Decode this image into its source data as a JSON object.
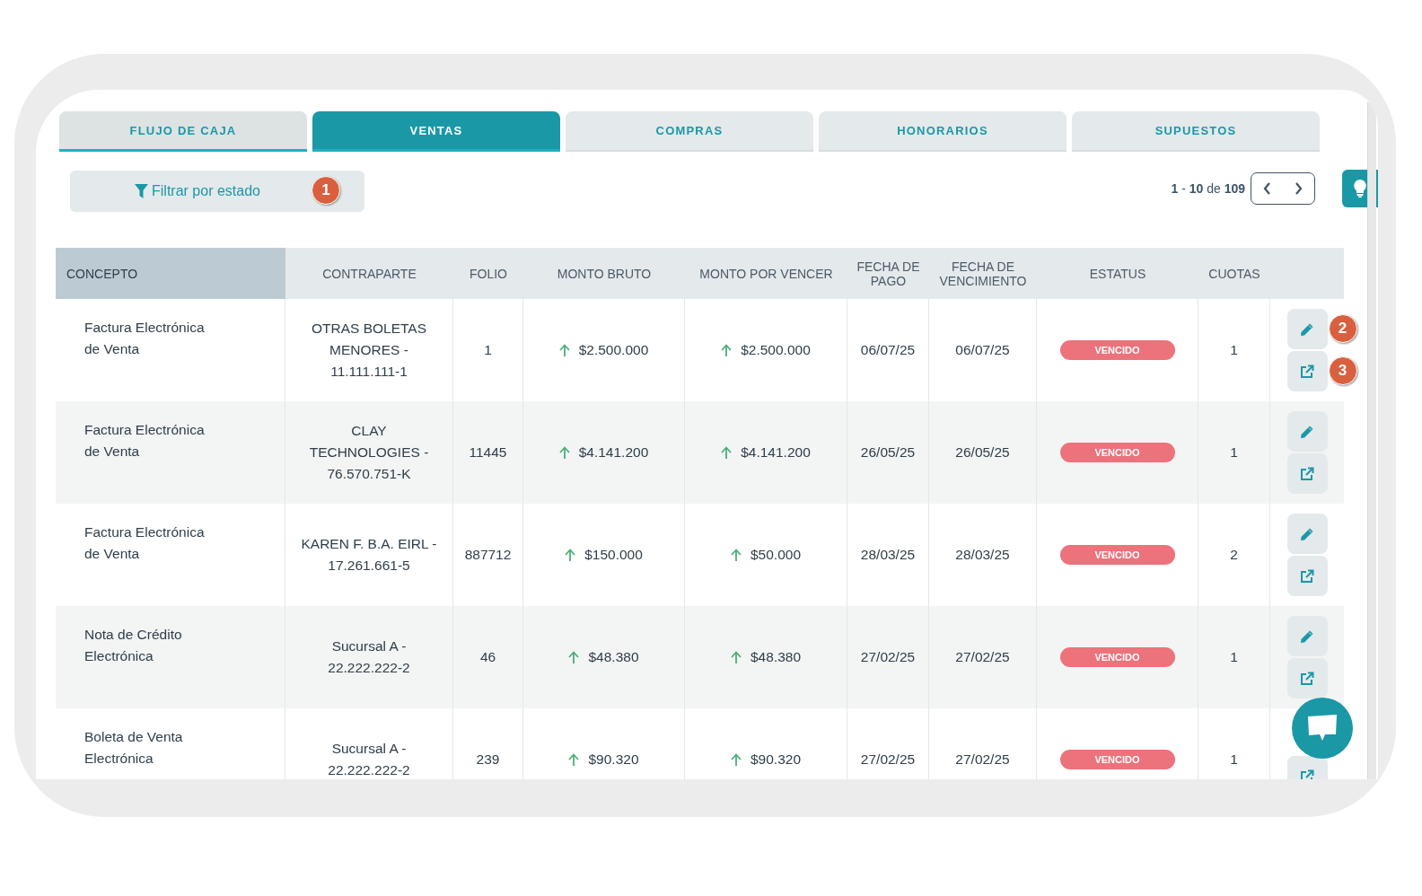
{
  "tabs": [
    {
      "label": "FLUJO DE CAJA",
      "selected": false,
      "hovered": true
    },
    {
      "label": "VENTAS",
      "selected": true,
      "hovered": false
    },
    {
      "label": "COMPRAS",
      "selected": false,
      "hovered": false
    },
    {
      "label": "HONORARIOS",
      "selected": false,
      "hovered": false
    },
    {
      "label": "SUPUESTOS",
      "selected": false,
      "hovered": false
    }
  ],
  "filter": {
    "label": "Filtrar por estado",
    "callout": "1"
  },
  "pagination": {
    "range": "**1** - **10** de **109**"
  },
  "table": {
    "columns": [
      "CONCEPTO",
      "CONTRAPARTE",
      "FOLIO",
      "MONTO BRUTO",
      "MONTO POR VENCER",
      "FECHA DE PAGO",
      "FECHA DE VENCIMIENTO",
      "ESTATUS",
      "CUOTAS"
    ],
    "rows": [
      {
        "concepto": "Factura Electrónica de Venta",
        "contraparte": "OTRAS BOLETAS MENORES - 11.111.111-1",
        "folio": "1",
        "monto_bruto": {
          "value": "$2.500.000",
          "rising": true
        },
        "monto_por_vencer": {
          "value": "$2.500.000",
          "rising": true
        },
        "fecha_pago": "06/07/25",
        "fecha_vencimiento": "06/07/25",
        "estatus": "VENCIDO",
        "cuotas": "1",
        "actions": [
          {
            "kind": "edit",
            "callout": "2"
          },
          {
            "kind": "open",
            "callout": "3"
          }
        ]
      },
      {
        "concepto": "Factura Electrónica de Venta",
        "contraparte": "CLAY TECHNOLOGIES - 76.570.751-K",
        "folio": "11445",
        "monto_bruto": {
          "value": "$4.141.200",
          "rising": true
        },
        "monto_por_vencer": {
          "value": "$4.141.200",
          "rising": true
        },
        "fecha_pago": "26/05/25",
        "fecha_vencimiento": "26/05/25",
        "estatus": "VENCIDO",
        "cuotas": "1",
        "actions": [
          {
            "kind": "edit"
          },
          {
            "kind": "open"
          }
        ]
      },
      {
        "concepto": "Factura Electrónica de Venta",
        "contraparte": "KAREN F. B.A. EIRL - 17.261.661-5",
        "folio": "887712",
        "monto_bruto": {
          "value": "$150.000",
          "rising": true
        },
        "monto_por_vencer": {
          "value": "$50.000",
          "rising": true
        },
        "fecha_pago": "28/03/25",
        "fecha_vencimiento": "28/03/25",
        "estatus": "VENCIDO",
        "cuotas": "2",
        "actions": [
          {
            "kind": "edit"
          },
          {
            "kind": "open"
          }
        ]
      },
      {
        "concepto": "Nota de Crédito Electrónica",
        "contraparte": "Sucursal A - 22.222.222-2",
        "folio": "46",
        "monto_bruto": {
          "value": "$48.380",
          "rising": true
        },
        "monto_por_vencer": {
          "value": "$48.380",
          "rising": true
        },
        "fecha_pago": "27/02/25",
        "fecha_vencimiento": "27/02/25",
        "estatus": "VENCIDO",
        "cuotas": "1",
        "actions": [
          {
            "kind": "edit"
          },
          {
            "kind": "open"
          }
        ]
      },
      {
        "concepto": "Boleta de Venta Electrónica",
        "contraparte": "Sucursal A - 22.222.222-2",
        "folio": "239",
        "monto_bruto": {
          "value": "$90.320",
          "rising": true
        },
        "monto_por_vencer": {
          "value": "$90.320",
          "rising": true
        },
        "fecha_pago": "27/02/25",
        "fecha_vencimiento": "27/02/25",
        "estatus": "VENCIDO",
        "cuotas": "1",
        "actions": [
          {
            "kind": "open"
          }
        ]
      }
    ]
  }
}
